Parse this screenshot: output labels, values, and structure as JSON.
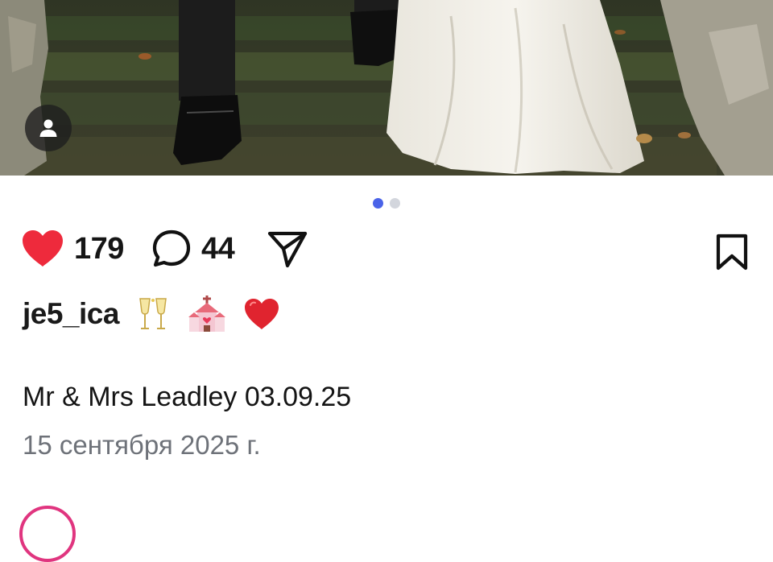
{
  "post": {
    "likes": "179",
    "comments": "44",
    "username": "je5_ica",
    "emojis": [
      "champagne-glasses",
      "wedding-chapel",
      "red-heart"
    ],
    "caption": "Mr & Mrs Leadley 03.09.25",
    "date": "15 сентября 2025 г."
  },
  "carousel": {
    "total": 2,
    "active": 1
  },
  "colors": {
    "like": "#ee2a3c",
    "active_dot": "#4a63e8",
    "inactive_dot": "#d3d6dd",
    "date_text": "#6e7279",
    "story_ring": "#e0357f"
  }
}
